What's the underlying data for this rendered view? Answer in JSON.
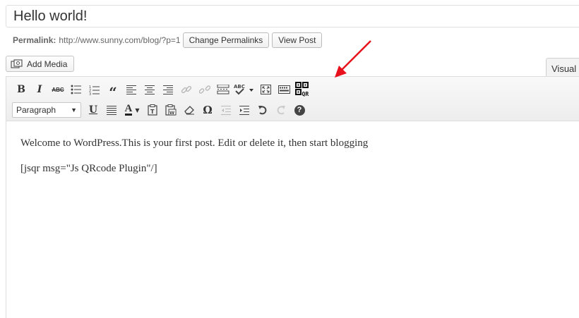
{
  "post": {
    "title": "Hello world!",
    "permalink_label": "Permalink:",
    "permalink_url": "http://www.sunny.com/blog/?p=1",
    "change_permalinks_label": "Change Permalinks",
    "view_post_label": "View Post"
  },
  "media": {
    "add_media_label": "Add Media"
  },
  "editor": {
    "visual_tab_label": "Visual",
    "format_select_value": "Paragraph",
    "content": {
      "paragraph_1": "Welcome to WordPress.This is your first post. Edit or delete it, then start blogging",
      "paragraph_2": "[jsqr msg=\"Js QRcode Plugin\"/]"
    },
    "toolbar": {
      "bold": "B",
      "italic": "I",
      "strikethrough": "ABC",
      "blockquote": "“",
      "omega": "Ω",
      "underline": "U",
      "text_color": "A",
      "help": "?",
      "qr_label": "QR"
    }
  },
  "colors": {
    "annotation_arrow": "#e8101a"
  }
}
